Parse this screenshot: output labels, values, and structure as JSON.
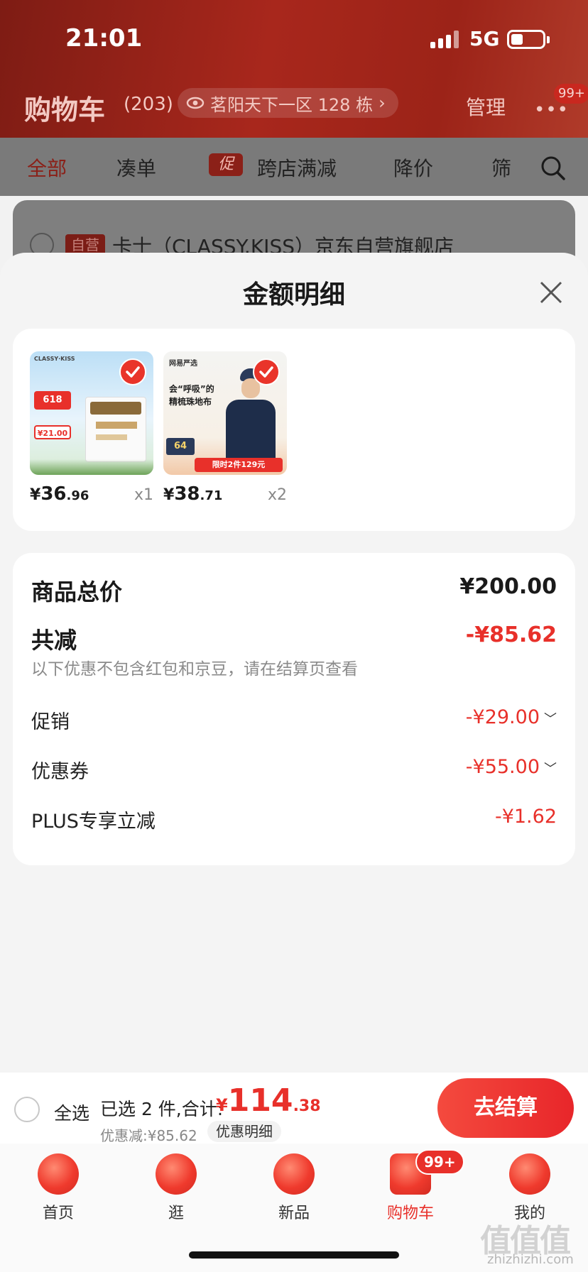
{
  "status": {
    "time": "21:01",
    "network": "5G"
  },
  "header": {
    "title": "购物车",
    "count": "(203)",
    "address": "茗阳天下一区 128 栋",
    "manage": "管理",
    "more_badge": "99+"
  },
  "filters": {
    "items": [
      "全部",
      "凑单",
      "跨店满减",
      "降价",
      "筛"
    ],
    "promo_tag": "促"
  },
  "store": {
    "tag": "自营",
    "name": "卡士（CLASSY.KISS）京东自营旗舰店"
  },
  "sheet": {
    "title": "金额明细",
    "products": [
      {
        "currency": "¥",
        "price_int": "36",
        "price_dec": ".96",
        "qty": "x1"
      },
      {
        "currency": "¥",
        "price_int": "38",
        "price_dec": ".71",
        "qty": "x2"
      }
    ],
    "product_art": {
      "p1_brand": "CLASSY·KISS",
      "p1_badge": "618",
      "p1_price": "¥21.00",
      "p2_brand": "网易严选",
      "p2_headline_1": "会“呼吸”的",
      "p2_headline_2": "精梳珠地布",
      "p2_price": "64",
      "p2_banner": "限时2件129元"
    },
    "detail": {
      "total_label": "商品总价",
      "total_value": "¥200.00",
      "reduce_label": "共减",
      "reduce_value": "-¥85.62",
      "note": "以下优惠不包含红包和京豆，请在结算页查看",
      "rows": [
        {
          "label": "促销",
          "value": "-¥29.00"
        },
        {
          "label": "优惠券",
          "value": "-¥55.00"
        },
        {
          "label": "PLUS专享立减",
          "value": "-¥1.62"
        }
      ]
    }
  },
  "checkout": {
    "select_all": "全选",
    "selected": "已选 2 件,合计:",
    "currency": "¥",
    "total_int": "114",
    "total_dec": ".38",
    "discount": "优惠减:¥85.62",
    "detail_btn": "优惠明细",
    "checkout_btn": "去结算"
  },
  "tabbar": {
    "items": [
      "首页",
      "逛",
      "新品",
      "购物车",
      "我的"
    ],
    "badge": "99+"
  },
  "watermark": {
    "main": "值值值",
    "sub": "zhizhizhi.com"
  },
  "colors": {
    "accent": "#e8302a",
    "dim_header": "#a8271c"
  }
}
